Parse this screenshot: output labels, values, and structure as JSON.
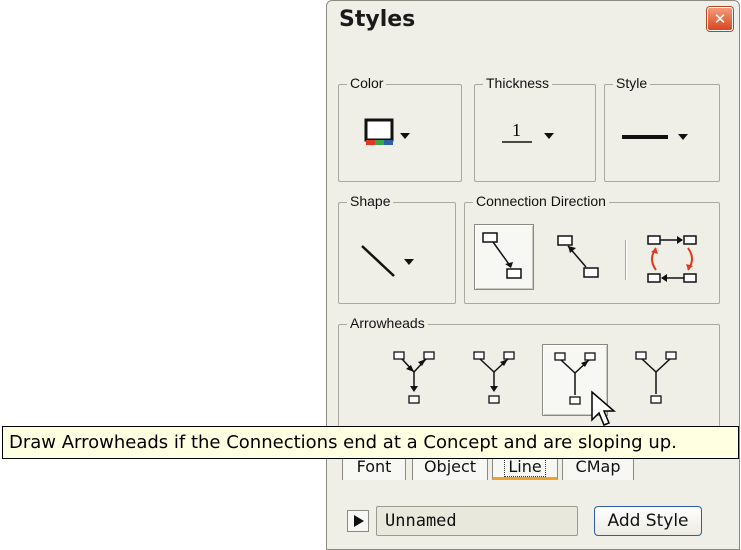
{
  "window": {
    "title": "Styles"
  },
  "groups": {
    "color": "Color",
    "thickness": "Thickness",
    "thickness_value": "1",
    "style": "Style",
    "shape": "Shape",
    "connection_direction": "Connection Direction",
    "arrowheads": "Arrowheads"
  },
  "tooltip": {
    "text": "Draw Arrowheads if the Connections end at a Concept and are sloping up."
  },
  "tabs": [
    {
      "label": "Font"
    },
    {
      "label": "Object"
    },
    {
      "label": "Line",
      "active": true
    },
    {
      "label": "CMap"
    }
  ],
  "footer": {
    "style_name": "Unnamed",
    "add_style_label": "Add Style"
  },
  "colors": {
    "accent_red": "#e03a1e",
    "tab_highlight": "#f0a02c",
    "panel_bg": "#efefe7",
    "tooltip_bg": "#ffffe1"
  },
  "icons": [
    "close-icon",
    "color-swatch-icon",
    "thickness-line-icon",
    "line-style-icon",
    "shape-line-icon",
    "dropdown-arrow-icon",
    "connection-forward-icon",
    "connection-backward-icon",
    "connection-bidirectional-icon",
    "arrowhead-option-icon",
    "mouse-cursor-icon",
    "play-icon"
  ]
}
